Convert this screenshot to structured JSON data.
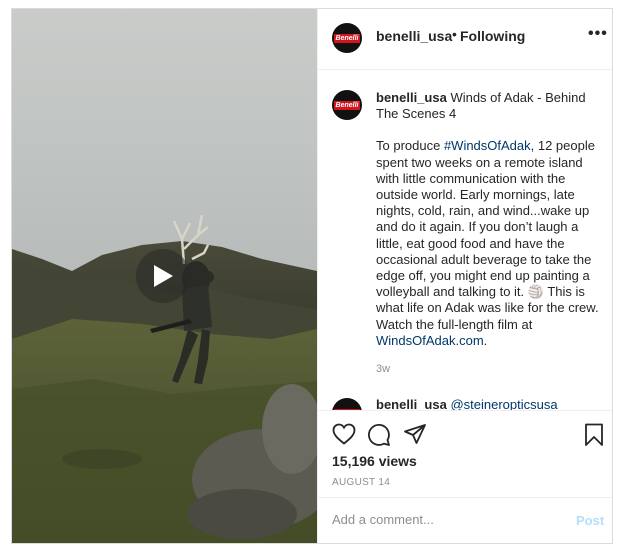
{
  "header": {
    "username": "benelli_usa",
    "bullet": "•",
    "follow_status": "Following",
    "more_label": "•••",
    "avatar_text": "Benelli"
  },
  "caption": {
    "username": "benelli_usa",
    "title": "Winds of Adak - Behind The Scenes 4",
    "text_before_tag": "To produce ",
    "hashtag": "#WindsOfAdak",
    "text_after_tag": ", 12 people spent two weeks on a remote island with little communication with the outside world. Early mornings, late nights, cold, rain, and wind...wake up and do it again. If you don’t laugh a little, eat good food and have the occasional adult beverage to take the edge off, you might end up painting a volleyball and talking to it. 🏐 This is what life on Adak was like for the crew. Watch the full-length film at ",
    "link": "WindsOfAdak.com",
    "text_end": ".",
    "time_ago": "3w"
  },
  "second_comment": {
    "username": "benelli_usa",
    "mention": "@steineropticsusa"
  },
  "stats": {
    "views": "15,196 views",
    "date": "AUGUST 14"
  },
  "comment_box": {
    "placeholder": "Add a comment...",
    "post_label": "Post"
  },
  "colors": {
    "link": "#00376b",
    "post_disabled": "#b2dffc",
    "meta_gray": "#8e8e8e",
    "brand_red": "#d3141c"
  },
  "icons": [
    "play-icon",
    "heart-icon",
    "comment-icon",
    "share-icon",
    "bookmark-icon",
    "more-options-icon"
  ]
}
